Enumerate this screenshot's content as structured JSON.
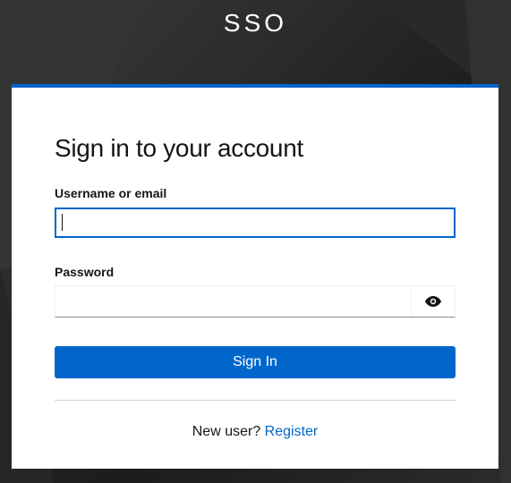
{
  "header": {
    "brand": "SSO"
  },
  "login": {
    "title": "Sign in to your account",
    "username_label": "Username or email",
    "username_value": "",
    "password_label": "Password",
    "password_value": "",
    "show_password_icon": "eye-icon",
    "submit_label": "Sign In",
    "register_prompt": "New user?",
    "register_link": "Register"
  },
  "colors": {
    "accent": "#0066cc",
    "background": "#1f1f1f",
    "card": "#ffffff",
    "text": "#151515"
  }
}
